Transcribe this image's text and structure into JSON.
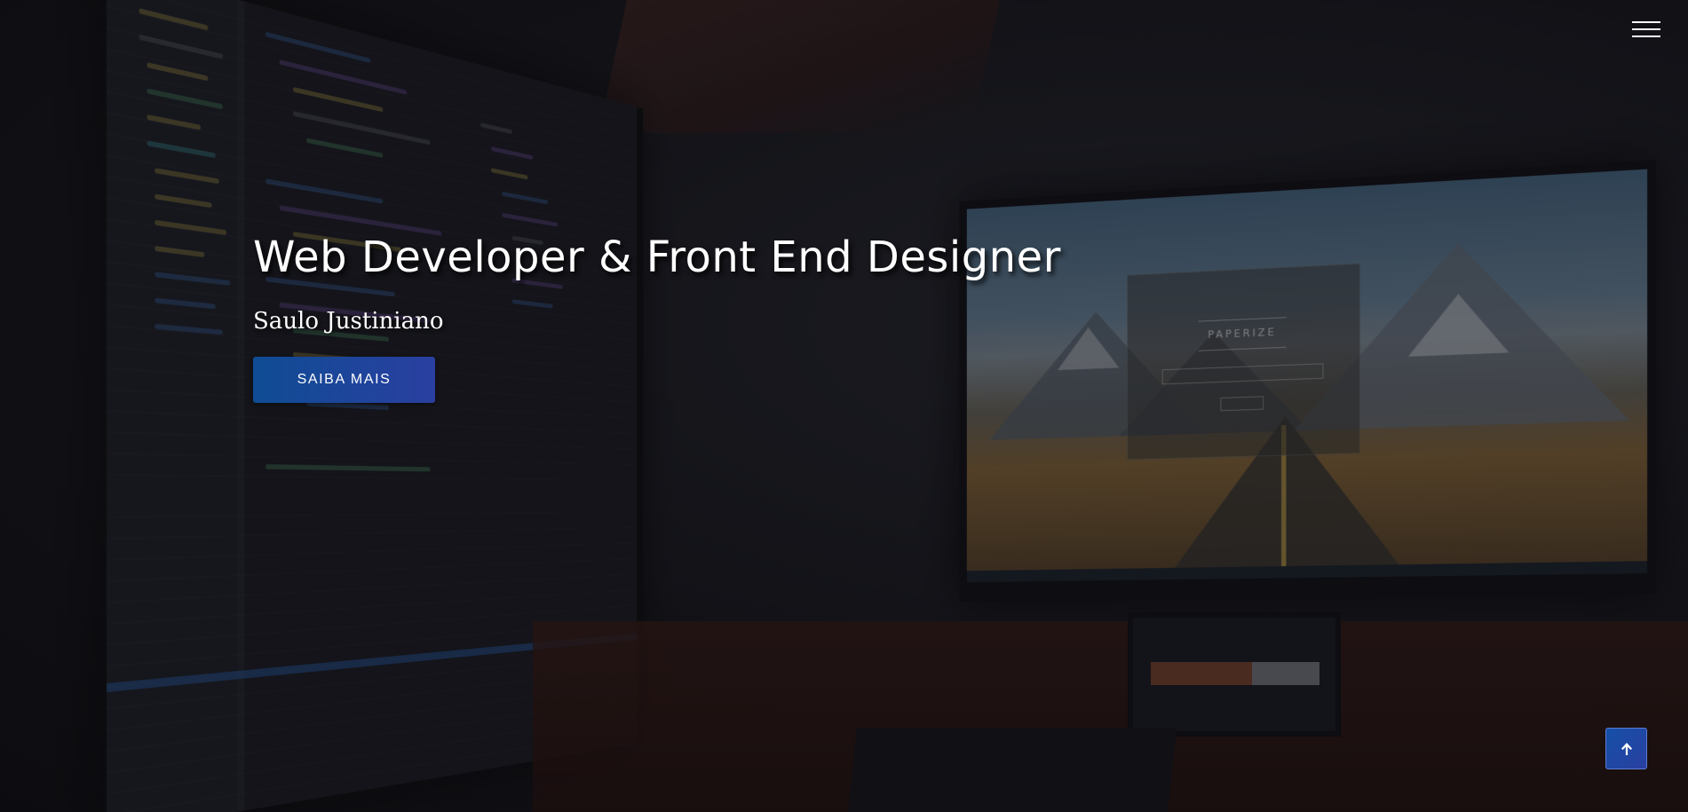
{
  "hero": {
    "title": "Web Developer & Front End Designer",
    "subtitle": "Saulo Justiniano",
    "cta_label": "SAIBA MAIS"
  },
  "background_screen": {
    "app_title": "PAPERIZE"
  },
  "icons": {
    "menu": "hamburger-menu-icon",
    "back_to_top": "arrow-up-icon"
  },
  "colors": {
    "accent": "#1550a8",
    "accent_end": "#2a3fa0",
    "text": "#ffffff",
    "background": "#15151a"
  }
}
